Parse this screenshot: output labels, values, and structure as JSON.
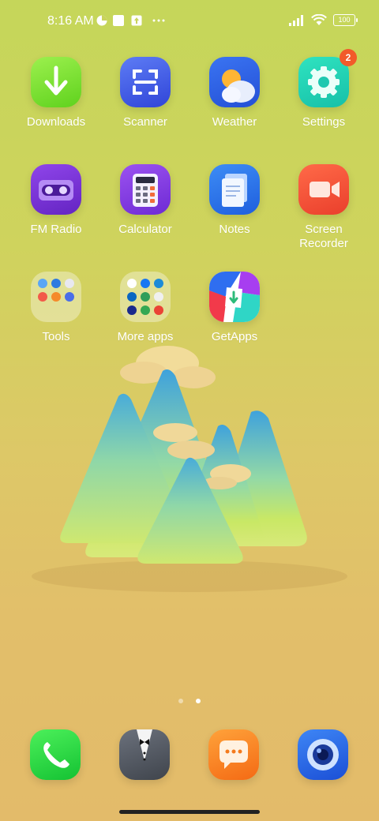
{
  "status_bar": {
    "time": "8:16 AM",
    "battery": "100",
    "icons": [
      "data-saver-icon",
      "square-notification-icon",
      "upload-notification-icon",
      "more-notifications-icon",
      "signal-icon",
      "wifi-icon",
      "battery-icon"
    ]
  },
  "apps": [
    {
      "label": "Downloads",
      "icon": "download-arrow-icon",
      "color": "#7be02c"
    },
    {
      "label": "Scanner",
      "icon": "scan-frame-icon",
      "color": "#3e5ae8"
    },
    {
      "label": "Weather",
      "icon": "sun-cloud-icon",
      "color": "#2f62e8"
    },
    {
      "label": "Settings",
      "icon": "gear-icon",
      "color": "#1fd6b6",
      "badge": "2"
    },
    {
      "label": "FM Radio",
      "icon": "cassette-icon",
      "color": "#7a34d8"
    },
    {
      "label": "Calculator",
      "icon": "calculator-icon",
      "color": "#8a3ee6"
    },
    {
      "label": "Notes",
      "icon": "notes-icon",
      "color": "#2e7bf0"
    },
    {
      "label": "Screen Recorder",
      "icon": "video-camera-icon",
      "color": "#f5553a"
    },
    {
      "label": "Tools",
      "icon": "folder-icon"
    },
    {
      "label": "More apps",
      "icon": "folder-icon"
    },
    {
      "label": "GetApps",
      "icon": "getapps-icon"
    }
  ],
  "pager": {
    "pages": 2,
    "current": 2
  },
  "dock": [
    {
      "name": "phone-icon",
      "color": "#22cc3c"
    },
    {
      "name": "butler-icon",
      "color": "#555b66"
    },
    {
      "name": "messages-icon",
      "color": "#f47a1c"
    },
    {
      "name": "camera-icon",
      "color": "#2565e6"
    }
  ]
}
